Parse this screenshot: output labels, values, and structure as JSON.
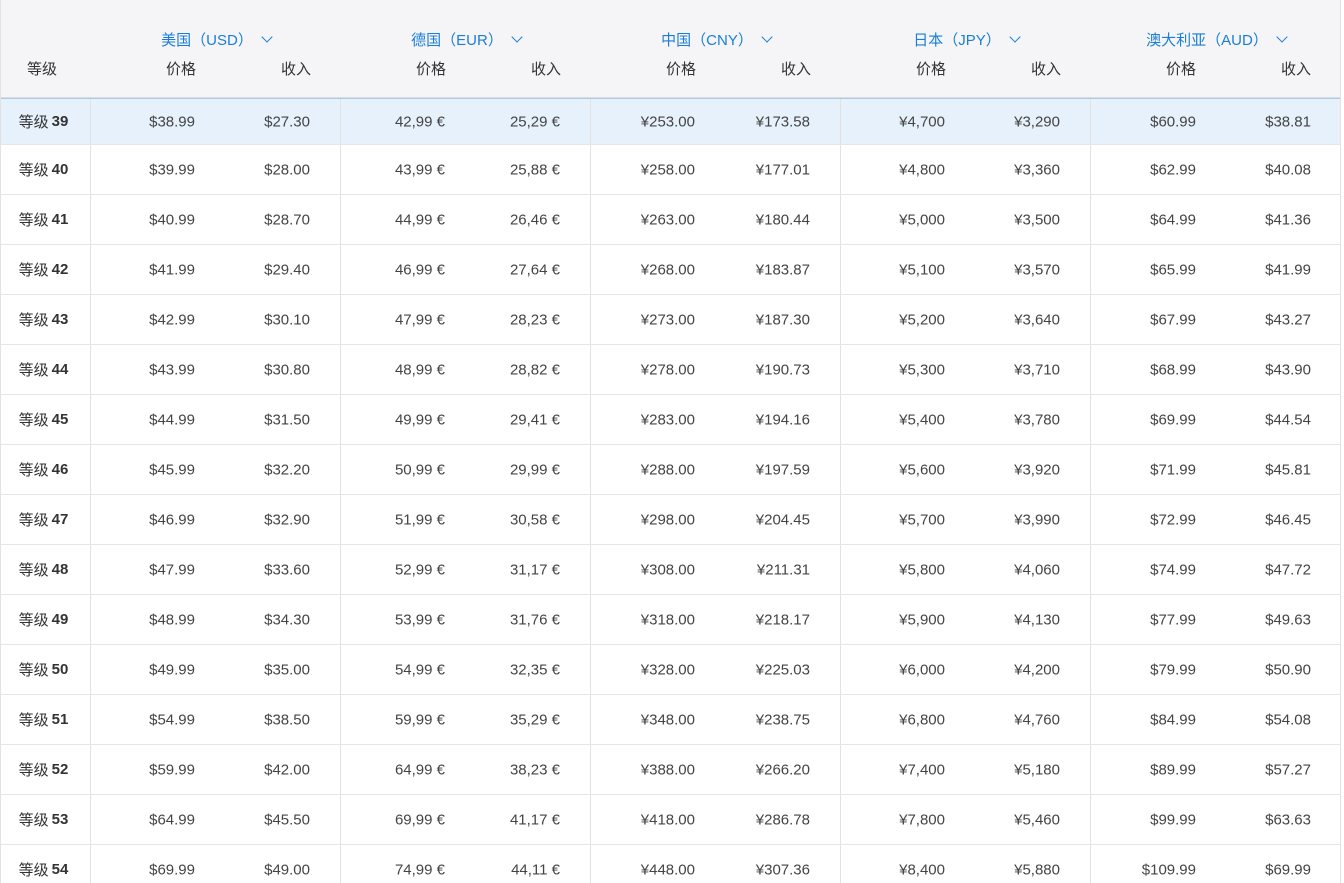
{
  "tier_header": "等级",
  "tier_prefix": "等级",
  "columns": {
    "price_label": "价格",
    "income_label": "收入"
  },
  "currencies": [
    {
      "label": "美国（USD）"
    },
    {
      "label": "德国（EUR）"
    },
    {
      "label": "中国（CNY）"
    },
    {
      "label": "日本（JPY）"
    },
    {
      "label": "澳大利亚（AUD）"
    }
  ],
  "rows": [
    {
      "tier": "39",
      "selected": true,
      "vals": [
        "$38.99",
        "$27.30",
        "42,99 €",
        "25,29 €",
        "¥253.00",
        "¥173.58",
        "¥4,700",
        "¥3,290",
        "$60.99",
        "$38.81"
      ]
    },
    {
      "tier": "40",
      "vals": [
        "$39.99",
        "$28.00",
        "43,99 €",
        "25,88 €",
        "¥258.00",
        "¥177.01",
        "¥4,800",
        "¥3,360",
        "$62.99",
        "$40.08"
      ]
    },
    {
      "tier": "41",
      "vals": [
        "$40.99",
        "$28.70",
        "44,99 €",
        "26,46 €",
        "¥263.00",
        "¥180.44",
        "¥5,000",
        "¥3,500",
        "$64.99",
        "$41.36"
      ]
    },
    {
      "tier": "42",
      "vals": [
        "$41.99",
        "$29.40",
        "46,99 €",
        "27,64 €",
        "¥268.00",
        "¥183.87",
        "¥5,100",
        "¥3,570",
        "$65.99",
        "$41.99"
      ]
    },
    {
      "tier": "43",
      "vals": [
        "$42.99",
        "$30.10",
        "47,99 €",
        "28,23 €",
        "¥273.00",
        "¥187.30",
        "¥5,200",
        "¥3,640",
        "$67.99",
        "$43.27"
      ]
    },
    {
      "tier": "44",
      "vals": [
        "$43.99",
        "$30.80",
        "48,99 €",
        "28,82 €",
        "¥278.00",
        "¥190.73",
        "¥5,300",
        "¥3,710",
        "$68.99",
        "$43.90"
      ]
    },
    {
      "tier": "45",
      "vals": [
        "$44.99",
        "$31.50",
        "49,99 €",
        "29,41 €",
        "¥283.00",
        "¥194.16",
        "¥5,400",
        "¥3,780",
        "$69.99",
        "$44.54"
      ]
    },
    {
      "tier": "46",
      "vals": [
        "$45.99",
        "$32.20",
        "50,99 €",
        "29,99 €",
        "¥288.00",
        "¥197.59",
        "¥5,600",
        "¥3,920",
        "$71.99",
        "$45.81"
      ]
    },
    {
      "tier": "47",
      "vals": [
        "$46.99",
        "$32.90",
        "51,99 €",
        "30,58 €",
        "¥298.00",
        "¥204.45",
        "¥5,700",
        "¥3,990",
        "$72.99",
        "$46.45"
      ]
    },
    {
      "tier": "48",
      "vals": [
        "$47.99",
        "$33.60",
        "52,99 €",
        "31,17 €",
        "¥308.00",
        "¥211.31",
        "¥5,800",
        "¥4,060",
        "$74.99",
        "$47.72"
      ]
    },
    {
      "tier": "49",
      "vals": [
        "$48.99",
        "$34.30",
        "53,99 €",
        "31,76 €",
        "¥318.00",
        "¥218.17",
        "¥5,900",
        "¥4,130",
        "$77.99",
        "$49.63"
      ]
    },
    {
      "tier": "50",
      "vals": [
        "$49.99",
        "$35.00",
        "54,99 €",
        "32,35 €",
        "¥328.00",
        "¥225.03",
        "¥6,000",
        "¥4,200",
        "$79.99",
        "$50.90"
      ]
    },
    {
      "tier": "51",
      "vals": [
        "$54.99",
        "$38.50",
        "59,99 €",
        "35,29 €",
        "¥348.00",
        "¥238.75",
        "¥6,800",
        "¥4,760",
        "$84.99",
        "$54.08"
      ]
    },
    {
      "tier": "52",
      "vals": [
        "$59.99",
        "$42.00",
        "64,99 €",
        "38,23 €",
        "¥388.00",
        "¥266.20",
        "¥7,400",
        "¥5,180",
        "$89.99",
        "$57.27"
      ]
    },
    {
      "tier": "53",
      "vals": [
        "$64.99",
        "$45.50",
        "69,99 €",
        "41,17 €",
        "¥418.00",
        "¥286.78",
        "¥7,800",
        "¥5,460",
        "$99.99",
        "$63.63"
      ]
    },
    {
      "tier": "54",
      "vals": [
        "$69.99",
        "$49.00",
        "74,99 €",
        "44,11 €",
        "¥448.00",
        "¥307.36",
        "¥8,400",
        "¥5,880",
        "$109.99",
        "$69.99"
      ]
    }
  ]
}
